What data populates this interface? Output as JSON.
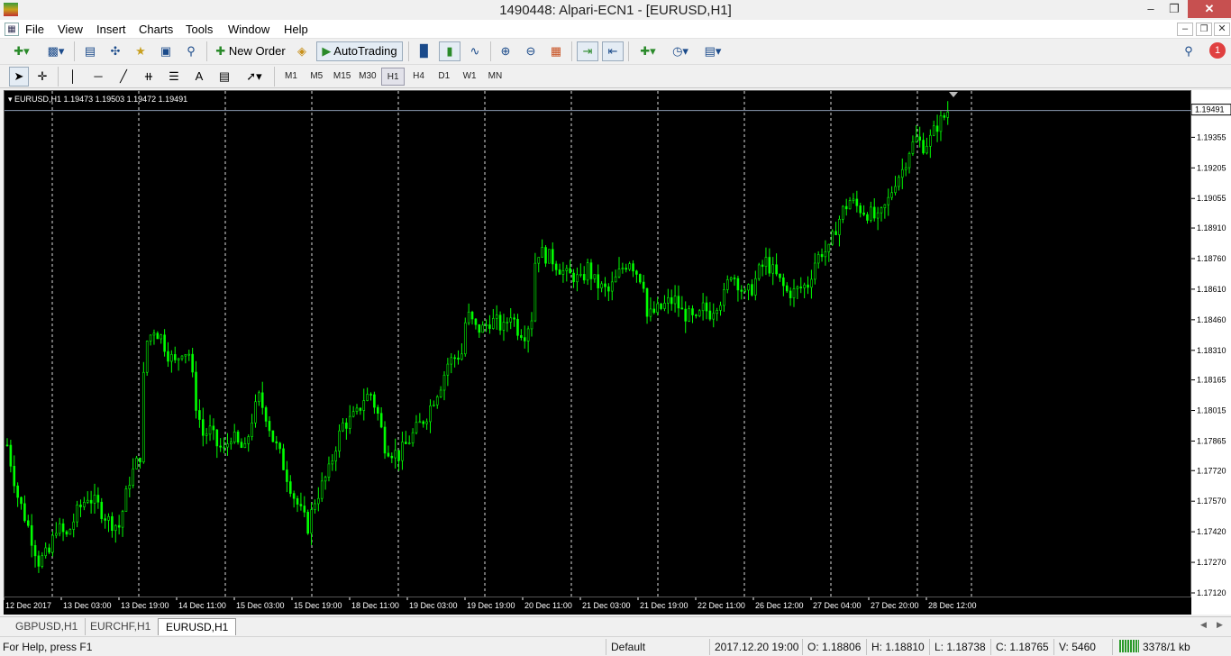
{
  "window": {
    "title": "1490448: Alpari-ECN1 - [EURUSD,H1]"
  },
  "menu": [
    "File",
    "View",
    "Insert",
    "Charts",
    "Tools",
    "Window",
    "Help"
  ],
  "toolbar": {
    "new_order": "New Order",
    "autotrading": "AutoTrading",
    "notification_count": "1"
  },
  "timeframes": [
    "M1",
    "M5",
    "M15",
    "M30",
    "H1",
    "H4",
    "D1",
    "W1",
    "MN"
  ],
  "active_timeframe": "H1",
  "chart": {
    "label": "EURUSD,H1  1.19473 1.19503 1.19472 1.19491",
    "current_price": "1.19491",
    "price_color": "#00ff00"
  },
  "chart_data": {
    "type": "candlestick",
    "symbol": "EURUSD",
    "timeframe": "H1",
    "ylim": [
      1.1712,
      1.1956
    ],
    "y_ticks": [
      "1.19355",
      "1.19205",
      "1.19055",
      "1.18910",
      "1.18760",
      "1.18610",
      "1.18460",
      "1.18310",
      "1.18165",
      "1.18015",
      "1.17865",
      "1.17720",
      "1.17570",
      "1.17420",
      "1.17270",
      "1.17120"
    ],
    "x_ticks": [
      "12 Dec 2017",
      "13 Dec 03:00",
      "13 Dec 19:00",
      "14 Dec 11:00",
      "15 Dec 03:00",
      "15 Dec 19:00",
      "18 Dec 11:00",
      "19 Dec 03:00",
      "19 Dec 19:00",
      "20 Dec 11:00",
      "21 Dec 03:00",
      "21 Dec 19:00",
      "22 Dec 11:00",
      "26 Dec 12:00",
      "27 Dec 04:00",
      "27 Dec 20:00",
      "28 Dec 12:00"
    ],
    "close_path": [
      [
        0,
        1.1785
      ],
      [
        3,
        1.176
      ],
      [
        6,
        1.1745
      ],
      [
        9,
        1.1728
      ],
      [
        12,
        1.1732
      ],
      [
        14,
        1.1745
      ],
      [
        17,
        1.174
      ],
      [
        20,
        1.1752
      ],
      [
        23,
        1.176
      ],
      [
        26,
        1.1755
      ],
      [
        29,
        1.1748
      ],
      [
        32,
        1.1745
      ],
      [
        35,
        1.1768
      ],
      [
        38,
        1.178
      ],
      [
        39,
        1.1818
      ],
      [
        40,
        1.1836
      ],
      [
        42,
        1.1842
      ],
      [
        44,
        1.1838
      ],
      [
        46,
        1.183
      ],
      [
        48,
        1.1825
      ],
      [
        50,
        1.1832
      ],
      [
        52,
        1.183
      ],
      [
        54,
        1.1805
      ],
      [
        56,
        1.179
      ],
      [
        58,
        1.1792
      ],
      [
        60,
        1.1785
      ],
      [
        62,
        1.1782
      ],
      [
        64,
        1.179
      ],
      [
        66,
        1.1785
      ],
      [
        68,
        1.1782
      ],
      [
        70,
        1.1798
      ],
      [
        72,
        1.1808
      ],
      [
        74,
        1.18
      ],
      [
        76,
        1.1788
      ],
      [
        78,
        1.178
      ],
      [
        80,
        1.177
      ],
      [
        82,
        1.176
      ],
      [
        84,
        1.1752
      ],
      [
        86,
        1.1745
      ],
      [
        88,
        1.1758
      ],
      [
        90,
        1.1765
      ],
      [
        92,
        1.1772
      ],
      [
        94,
        1.1785
      ],
      [
        96,
        1.1795
      ],
      [
        98,
        1.1797
      ],
      [
        100,
        1.18
      ],
      [
        102,
        1.1808
      ],
      [
        104,
        1.181
      ],
      [
        106,
        1.18
      ],
      [
        108,
        1.1785
      ],
      [
        110,
        1.1782
      ],
      [
        112,
        1.178
      ],
      [
        114,
        1.1785
      ],
      [
        116,
        1.179
      ],
      [
        118,
        1.1795
      ],
      [
        120,
        1.18
      ],
      [
        122,
        1.1808
      ],
      [
        124,
        1.1815
      ],
      [
        126,
        1.1825
      ],
      [
        128,
        1.1828
      ],
      [
        130,
        1.183
      ],
      [
        131,
        1.1845
      ],
      [
        132,
        1.1848
      ],
      [
        134,
        1.1842
      ],
      [
        136,
        1.1842
      ],
      [
        138,
        1.1846
      ],
      [
        140,
        1.1845
      ],
      [
        142,
        1.1842
      ],
      [
        144,
        1.185
      ],
      [
        146,
        1.1842
      ],
      [
        148,
        1.184
      ],
      [
        150,
        1.1848
      ],
      [
        151,
        1.1875
      ],
      [
        152,
        1.188
      ],
      [
        154,
        1.1878
      ],
      [
        156,
        1.1876
      ],
      [
        158,
        1.1872
      ],
      [
        160,
        1.1868
      ],
      [
        162,
        1.1868
      ],
      [
        164,
        1.1865
      ],
      [
        166,
        1.1872
      ],
      [
        168,
        1.1865
      ],
      [
        170,
        1.1862
      ],
      [
        172,
        1.186
      ],
      [
        174,
        1.1866
      ],
      [
        176,
        1.1872
      ],
      [
        178,
        1.1876
      ],
      [
        180,
        1.187
      ],
      [
        182,
        1.1865
      ],
      [
        183,
        1.1848
      ],
      [
        185,
        1.185
      ],
      [
        187,
        1.1852
      ],
      [
        189,
        1.1855
      ],
      [
        191,
        1.1856
      ],
      [
        193,
        1.185
      ],
      [
        195,
        1.1848
      ],
      [
        197,
        1.1845
      ],
      [
        199,
        1.1852
      ],
      [
        201,
        1.185
      ],
      [
        203,
        1.1855
      ],
      [
        205,
        1.1858
      ],
      [
        207,
        1.187
      ],
      [
        209,
        1.1865
      ],
      [
        211,
        1.1858
      ],
      [
        213,
        1.1862
      ],
      [
        215,
        1.187
      ],
      [
        217,
        1.1875
      ],
      [
        219,
        1.187
      ],
      [
        221,
        1.1865
      ],
      [
        223,
        1.186
      ],
      [
        225,
        1.186
      ],
      [
        227,
        1.1862
      ],
      [
        229,
        1.1864
      ],
      [
        231,
        1.1875
      ],
      [
        233,
        1.188
      ],
      [
        235,
        1.188
      ],
      [
        237,
        1.1892
      ],
      [
        239,
        1.19
      ],
      [
        241,
        1.1905
      ],
      [
        243,
        1.1902
      ],
      [
        245,
        1.19
      ],
      [
        247,
        1.1898
      ],
      [
        249,
        1.1895
      ],
      [
        250,
        1.1898
      ],
      [
        252,
        1.1905
      ],
      [
        254,
        1.1915
      ],
      [
        256,
        1.192
      ],
      [
        258,
        1.193
      ],
      [
        260,
        1.1935
      ],
      [
        262,
        1.1932
      ],
      [
        264,
        1.1935
      ],
      [
        266,
        1.1942
      ],
      [
        268,
        1.1946
      ],
      [
        269,
        1.1949
      ]
    ]
  },
  "tabs": [
    "GBPUSD,H1",
    "EURCHF,H1",
    "EURUSD,H1"
  ],
  "active_tab": "EURUSD,H1",
  "status": {
    "help": "For Help, press F1",
    "profile": "Default",
    "time": "2017.12.20 19:00",
    "open": "O: 1.18806",
    "high": "H: 1.18810",
    "low": "L: 1.18738",
    "close": "C: 1.18765",
    "volume": "V: 5460",
    "traffic": "3378/1 kb"
  }
}
